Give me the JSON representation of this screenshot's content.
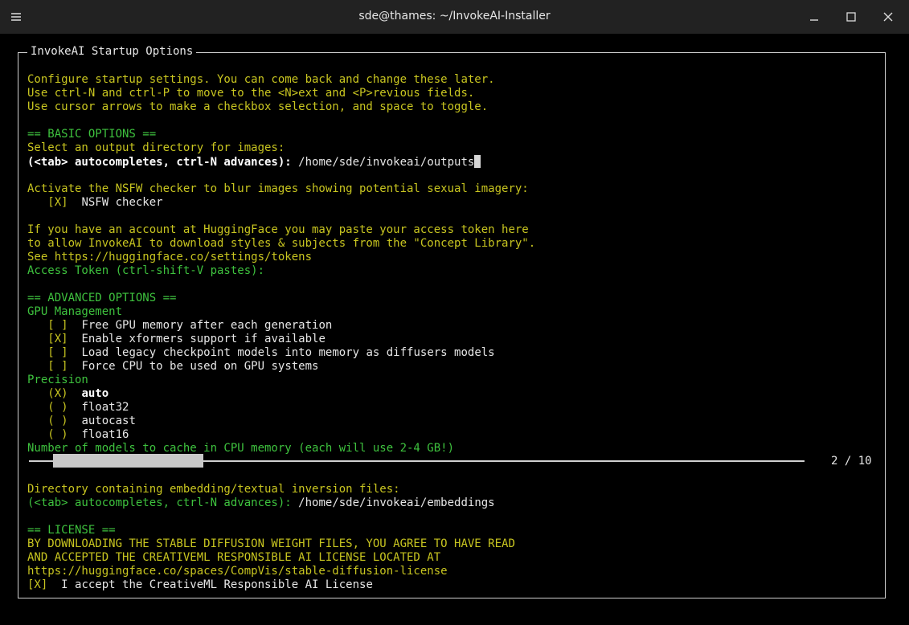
{
  "window": {
    "title": "sde@thames: ~/InvokeAI-Installer"
  },
  "dialog": {
    "title": "InvokeAI Startup Options",
    "intro": [
      "Configure startup settings. You can come back and change these later.",
      "Use ctrl-N and ctrl-P to move to the <N>ext and <P>revious fields.",
      "Use cursor arrows to make a checkbox selection, and space to toggle."
    ],
    "basic_header": "== BASIC OPTIONS ==",
    "outdir_prompt": "Select an output directory for images:",
    "outdir_label": "(<tab> autocompletes, ctrl-N advances):",
    "outdir_value": "/home/sde/invokeai/outputs",
    "nsfw_prompt": "Activate the NSFW checker to blur images showing potential sexual imagery:",
    "nsfw": {
      "mark": "[X]",
      "label": "NSFW checker"
    },
    "hf_lines": [
      "If you have an account at HuggingFace you may paste your access token here",
      "to allow InvokeAI to download styles & subjects from the \"Concept Library\".",
      "See https://huggingface.co/settings/tokens"
    ],
    "token_label": "Access Token (ctrl-shift-V pastes):",
    "advanced_header": "== ADVANCED OPTIONS ==",
    "gpu_header": "GPU Management",
    "gpu_options": [
      {
        "mark": "[ ]",
        "label": "Free GPU memory after each generation"
      },
      {
        "mark": "[X]",
        "label": "Enable xformers support if available"
      },
      {
        "mark": "[ ]",
        "label": "Load legacy checkpoint models into memory as diffusers models"
      },
      {
        "mark": "[ ]",
        "label": "Force CPU to be used on GPU systems"
      }
    ],
    "precision_header": "Precision",
    "precision_options": [
      {
        "mark": "(X)",
        "label": "auto"
      },
      {
        "mark": "( )",
        "label": "float32"
      },
      {
        "mark": "( )",
        "label": "autocast"
      },
      {
        "mark": "( )",
        "label": "float16"
      }
    ],
    "cache_label": "Number of models to cache in CPU memory (each will use 2-4 GB!)",
    "cache_slider": {
      "value": 2,
      "max": 10,
      "display": "2 / 10"
    },
    "embed_prompt": "Directory containing embedding/textual inversion files:",
    "embed_label": "(<tab> autocompletes, ctrl-N advances):",
    "embed_value": "/home/sde/invokeai/embeddings",
    "license_header": "== LICENSE ==",
    "license_lines": [
      "BY DOWNLOADING THE STABLE DIFFUSION WEIGHT FILES, YOU AGREE TO HAVE READ",
      "AND ACCEPTED THE CREATIVEML RESPONSIBLE AI LICENSE LOCATED AT",
      "https://huggingface.co/spaces/CompVis/stable-diffusion-license"
    ],
    "license_accept": {
      "mark": "[X]",
      "label": "I accept the CreativeML Responsible AI License"
    }
  }
}
